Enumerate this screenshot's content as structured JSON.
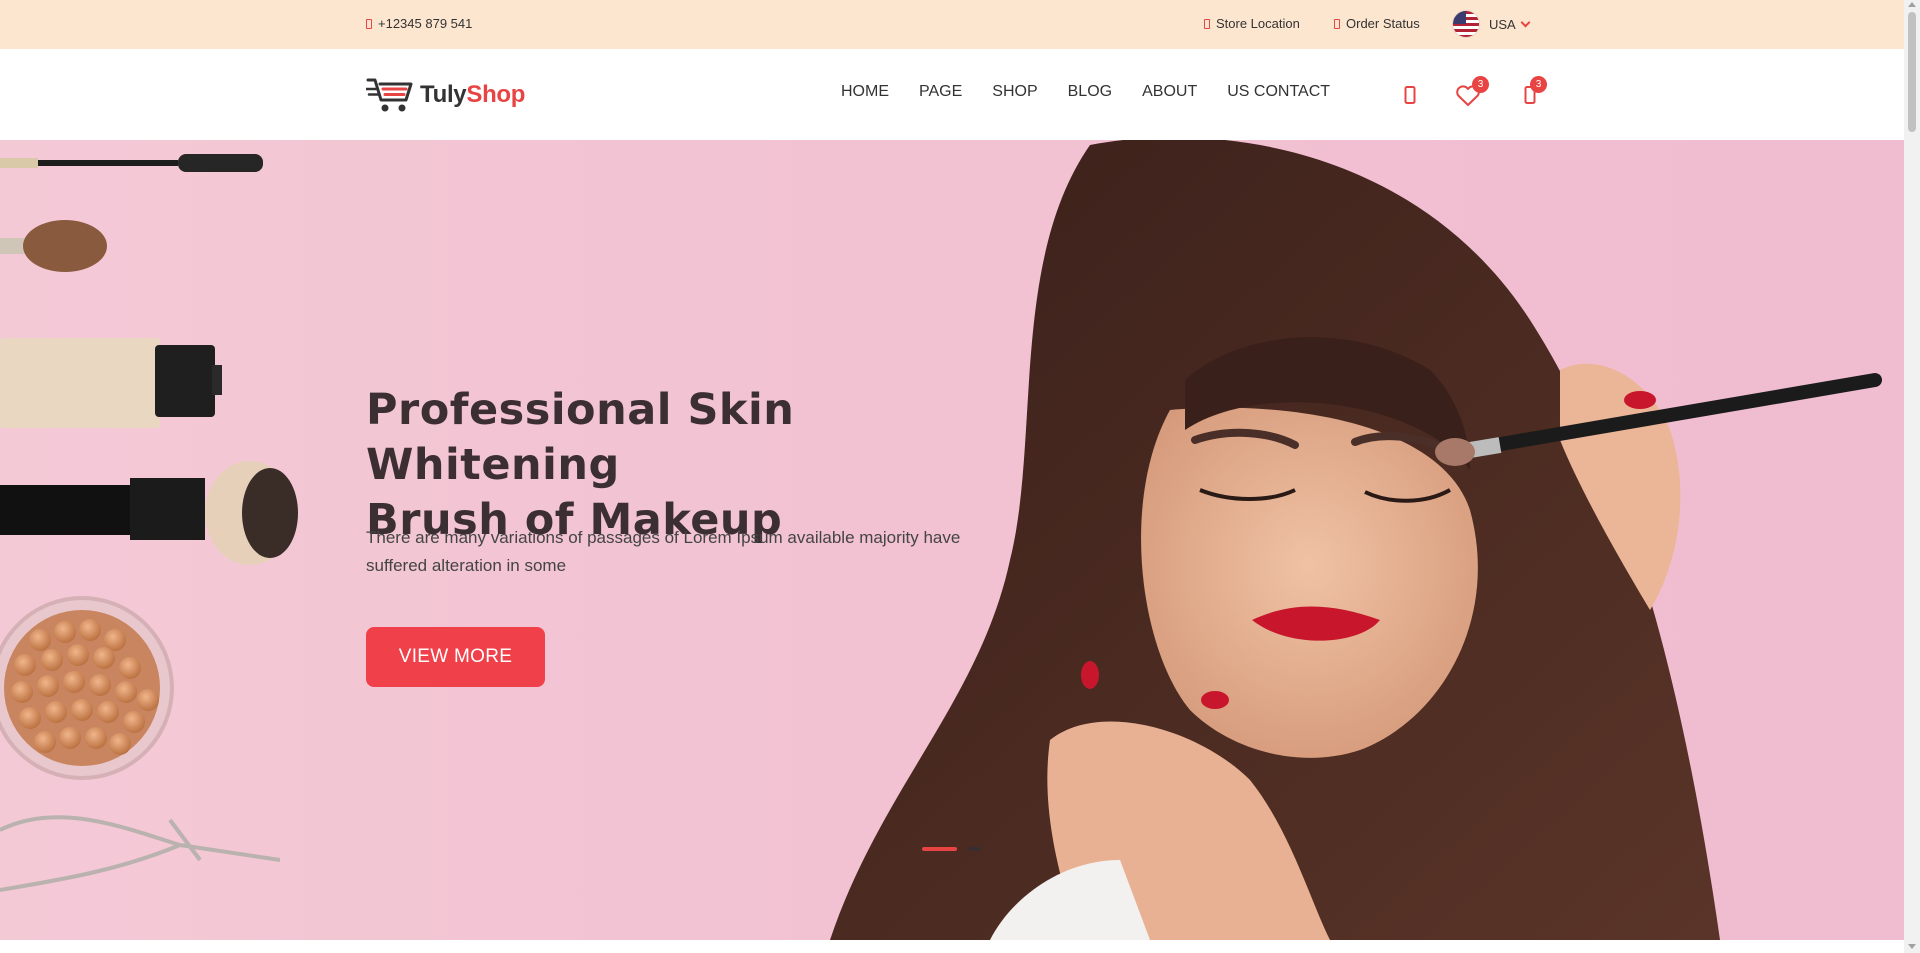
{
  "topbar": {
    "phone": "+12345 879 541",
    "store_location": "Store Location",
    "order_status": "Order Status",
    "country": "USA"
  },
  "header": {
    "logo": {
      "part1": "Tuly",
      "part2": "Shop"
    },
    "nav": [
      "HOME",
      "PAGE",
      "SHOP",
      "BLOG",
      "ABOUT",
      "US CONTACT"
    ],
    "wishlist_count": "3",
    "cart_count": "3"
  },
  "hero": {
    "title_line1": "Professional Skin Whitening",
    "title_line2": "Brush of Makeup",
    "description_line1": "There are many variations of passages of Lorem Ipsum available majority have",
    "description_line2": "suffered alteration in some",
    "button_label": "VIEW MORE",
    "slide_current": 1,
    "slide_total": 2
  },
  "colors": {
    "accent": "#e84444",
    "topbar_bg": "#fde6cf",
    "hero_bg": "#f2c2d2"
  },
  "icons": {
    "phone": "phone-icon",
    "store": "map-pin-icon",
    "order": "box-icon",
    "user": "user-icon",
    "wishlist": "heart-icon",
    "cart": "shopping-bag-icon"
  }
}
